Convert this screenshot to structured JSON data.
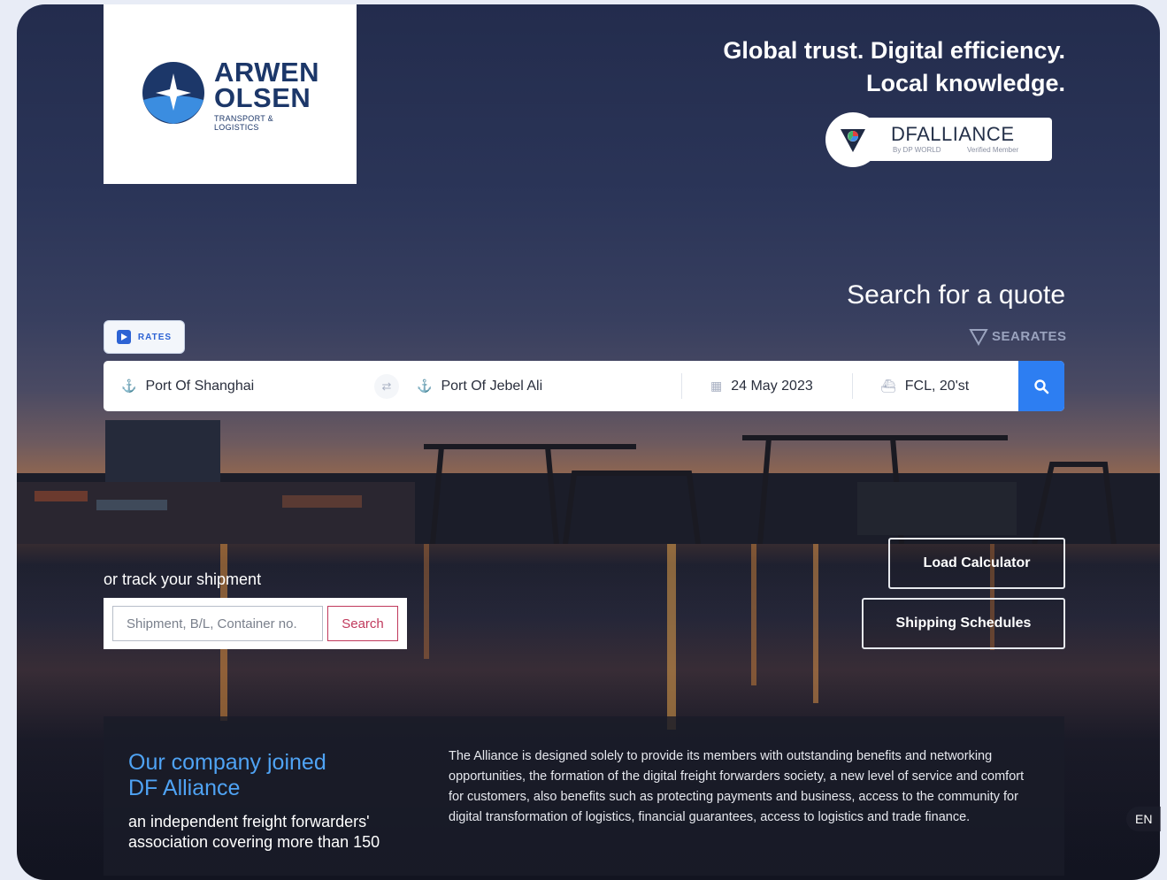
{
  "brand": {
    "name_line1": "ARWEN",
    "name_line2": "OLSEN",
    "subtitle": "TRANSPORT & LOGISTICS"
  },
  "tagline": {
    "line1": "Global trust. Digital efficiency.",
    "line2": "Local knowledge."
  },
  "dfalliance": {
    "title": "DFALLIANCE",
    "by": "By DP WORLD",
    "verified": "Verified Member"
  },
  "quote": {
    "title": "Search for a quote",
    "powered_by": "SEARATES",
    "tab_label": "RATES",
    "origin": "Port Of Shanghai",
    "destination": "Port Of Jebel Ali",
    "date": "24 May 2023",
    "container": "FCL, 20'st"
  },
  "track": {
    "label": "or track your shipment",
    "placeholder": "Shipment, B/L, Container no.",
    "button": "Search"
  },
  "actions": {
    "load_calculator": "Load Calculator",
    "shipping_schedules": "Shipping Schedules"
  },
  "info": {
    "title_line1": "Our company joined",
    "title_line2": "DF Alliance",
    "subtitle": "an independent freight forwarders' association covering more than 150",
    "body": "The Alliance is designed solely to provide its members with outstanding benefits and networking opportunities, the formation of the digital freight forwarders society, a new level of service and comfort for customers, also benefits such as protecting payments and business, access to the community for digital transformation of logistics, financial guarantees, access to logistics and trade finance."
  },
  "language": "EN",
  "colors": {
    "brand_navy": "#1c3769",
    "accent_blue": "#2d7ef2",
    "link_blue": "#4fa3f4",
    "search_red": "#c0395c"
  }
}
